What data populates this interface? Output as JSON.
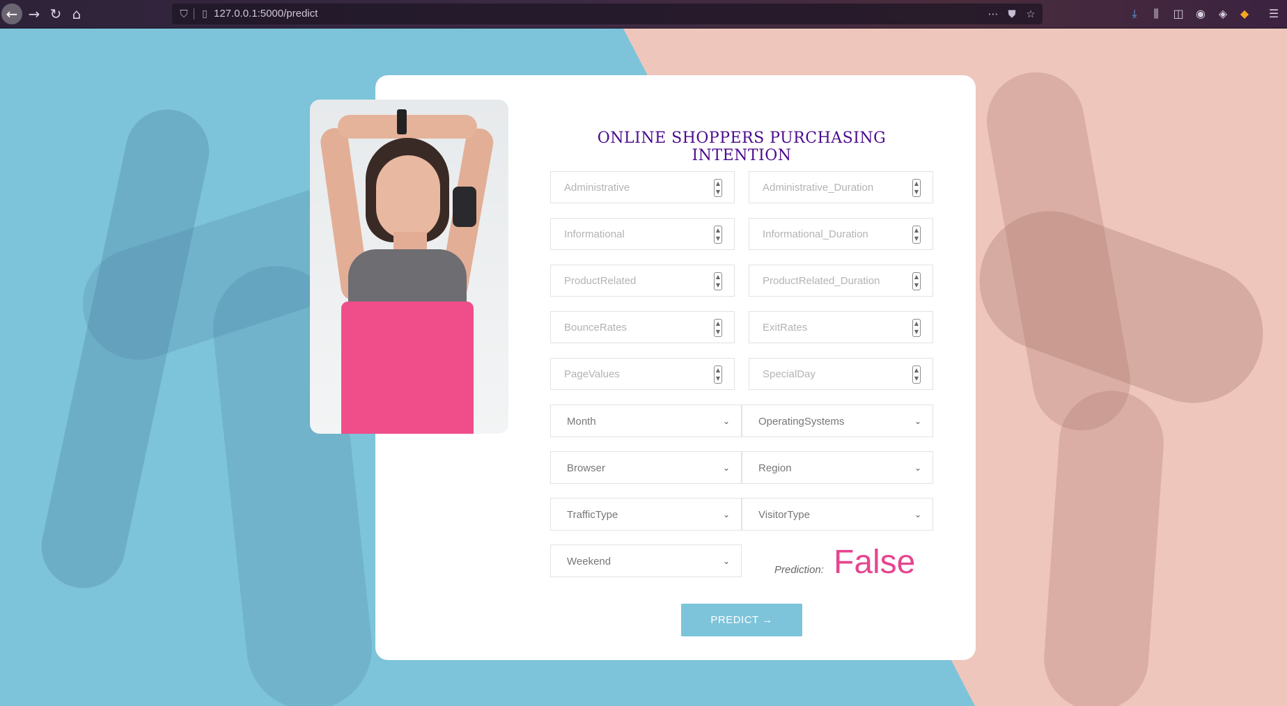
{
  "browser": {
    "url": "127.0.0.1:5000/predict"
  },
  "page": {
    "title": "ONLINE SHOPPERS PURCHASING INTENTION",
    "numeric_fields": [
      {
        "placeholder": "Administrative"
      },
      {
        "placeholder": "Administrative_Duration"
      },
      {
        "placeholder": "Informational"
      },
      {
        "placeholder": "Informational_Duration"
      },
      {
        "placeholder": "ProductRelated"
      },
      {
        "placeholder": "ProductRelated_Duration"
      },
      {
        "placeholder": "BounceRates"
      },
      {
        "placeholder": "ExitRates"
      },
      {
        "placeholder": "PageValues"
      },
      {
        "placeholder": "SpecialDay"
      }
    ],
    "select_fields": [
      {
        "value": "Month"
      },
      {
        "value": "OperatingSystems"
      },
      {
        "value": "Browser"
      },
      {
        "value": "Region"
      },
      {
        "value": "TrafficType"
      },
      {
        "value": "VisitorType"
      },
      {
        "value": "Weekend"
      }
    ],
    "prediction_label": "Prediction:",
    "prediction_value": "False",
    "predict_button": "PREDICT →"
  },
  "colors": {
    "accent_blue": "#7dc4da",
    "background_pink": "#efc6bc",
    "title_purple": "#4a0a8c",
    "prediction_pink": "#e6458f"
  }
}
